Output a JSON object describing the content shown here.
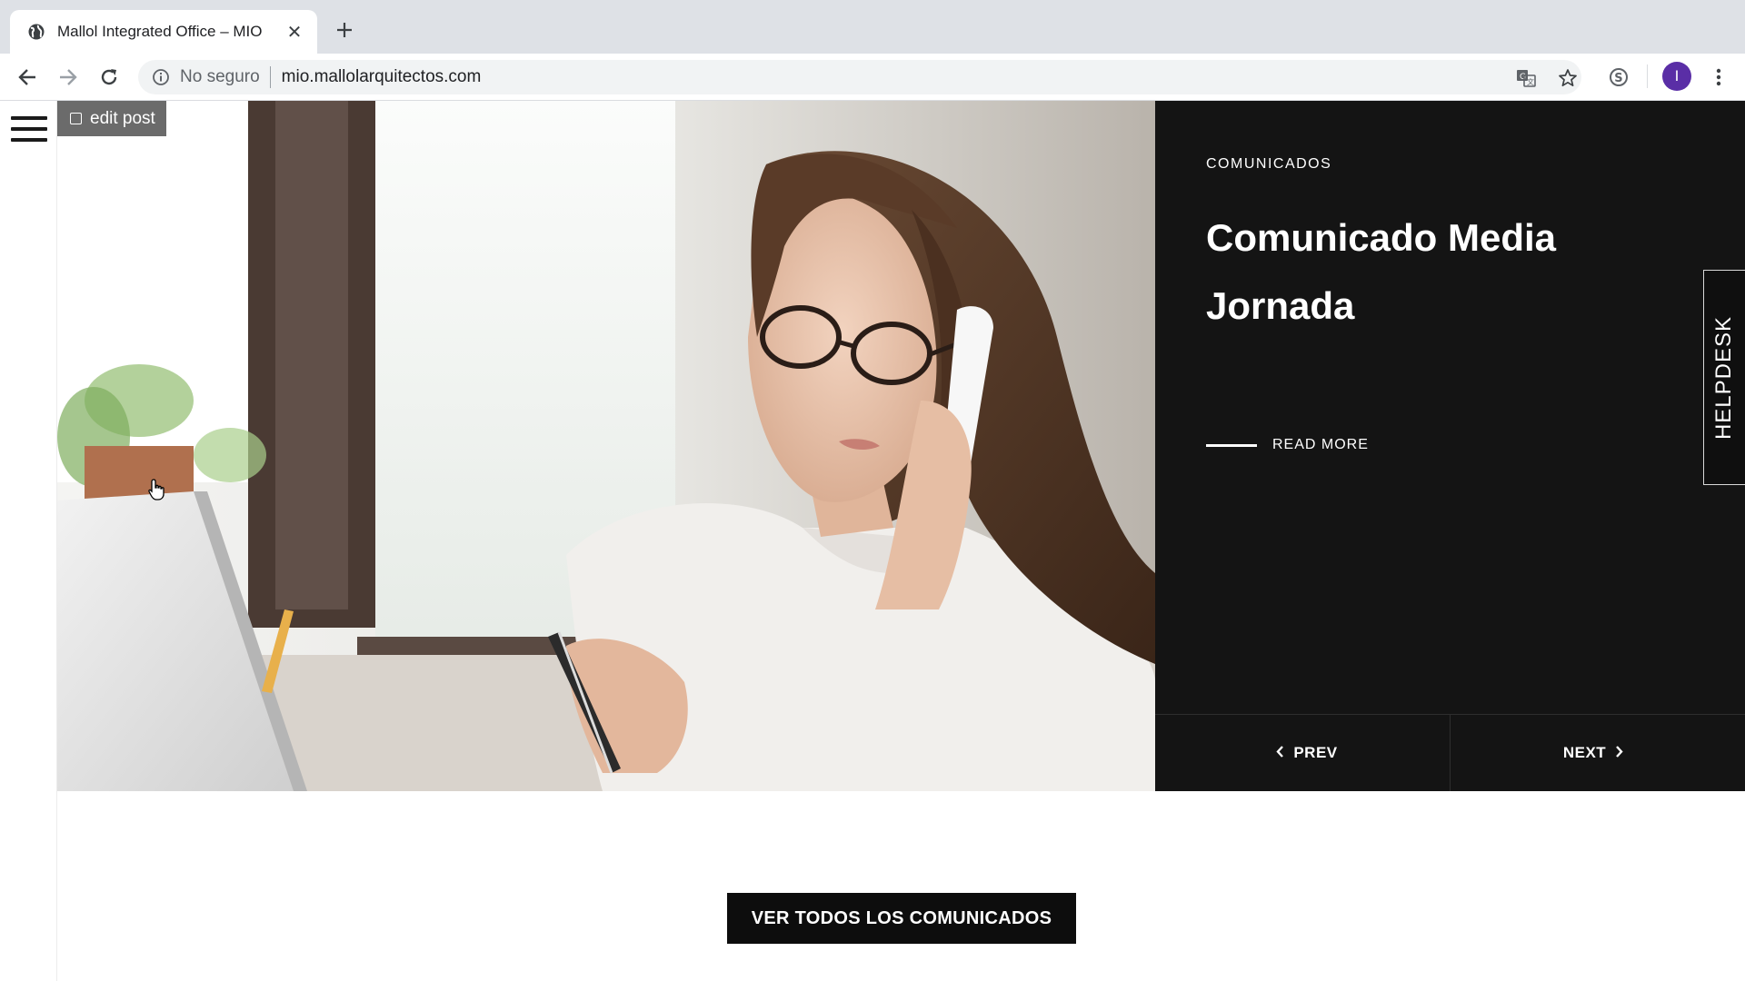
{
  "browser": {
    "tab": {
      "title": "Mallol Integrated Office – MIO",
      "favicon": "globe-icon",
      "close": "✕"
    },
    "new_tab": "+",
    "address_bar": {
      "security_label": "No seguro",
      "url": "mio.mallolarquitectos.com"
    },
    "toolbar_icons": [
      "back-icon",
      "forward-icon",
      "reload-icon",
      "info-icon",
      "translate-icon",
      "star-icon",
      "skype-icon",
      "menu-dots-icon"
    ],
    "profile_initial": "I",
    "profile_color": "#5a2ea6"
  },
  "admin": {
    "edit_post_label": "edit post"
  },
  "hero": {
    "category": "COMUNICADOS",
    "title": "Comunicado Media Jornada",
    "read_more": "READ MORE",
    "prev_label": "PREV",
    "next_label": "NEXT",
    "image_alt": "woman-on-phone-photo"
  },
  "helpdesk_label": "HELPDESK",
  "cta_label": "VER TODOS LOS COMUNICADOS",
  "colors": {
    "dark_panel": "#141414",
    "cta_bg": "#0d0d0d",
    "edit_post_bg": "#6b6b6b",
    "chrome_tabstrip": "#dee1e6"
  }
}
